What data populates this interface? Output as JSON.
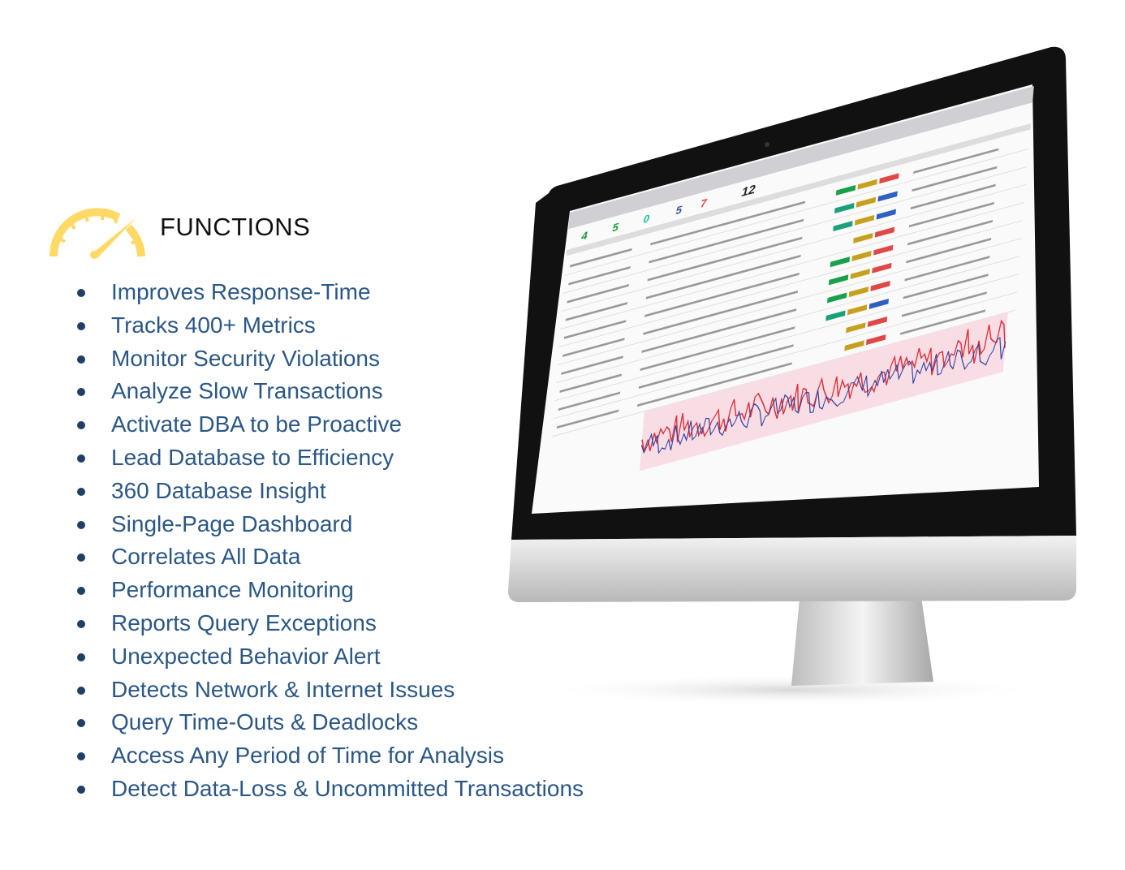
{
  "header": {
    "title": "FUNCTIONS",
    "icon": "speedometer-icon",
    "icon_color": "#FFD966"
  },
  "features": [
    "Improves Response-Time",
    "Tracks 400+ Metrics",
    "Monitor Security Violations",
    "Analyze Slow Transactions",
    "Activate DBA to be Proactive",
    "Lead Database to Efficiency",
    "360 Database Insight",
    "Single-Page Dashboard",
    "Correlates All Data",
    "Performance Monitoring",
    "Reports Query Exceptions",
    "Unexpected Behavior Alert",
    "Detects Network & Internet Issues",
    "Query Time-Outs & Deadlocks",
    "Access Any Period of Time for Analysis",
    "Detect Data-Loss & Uncommitted Transactions"
  ],
  "colors": {
    "feature_text": "#2b5786",
    "title_text": "#111111"
  },
  "monitor_screen_counters": [
    "4",
    "5",
    "0",
    "5",
    "7",
    "12"
  ]
}
